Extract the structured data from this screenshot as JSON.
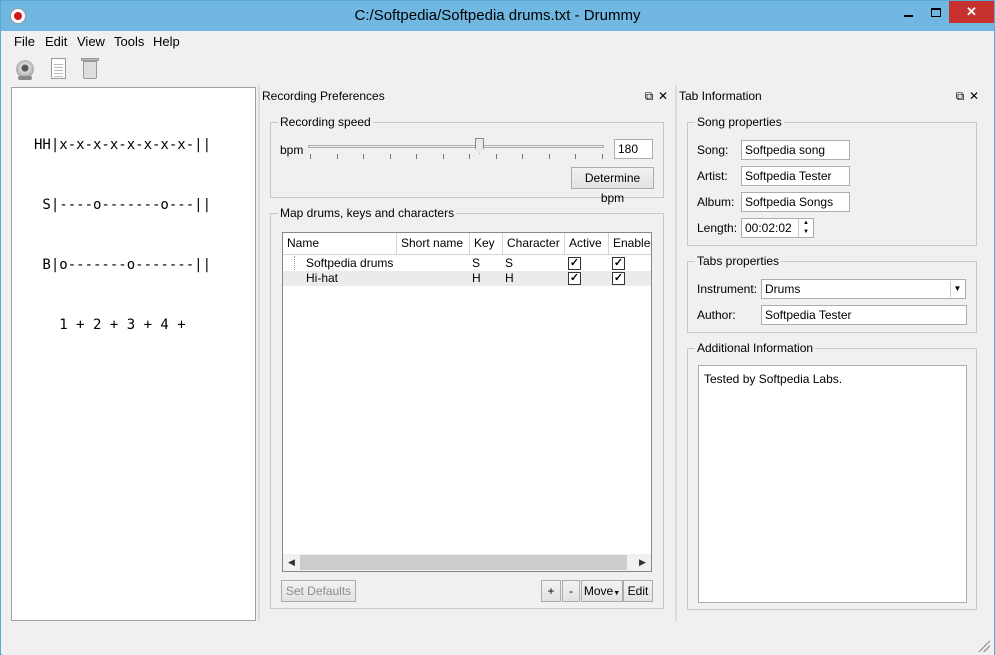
{
  "window": {
    "title": "C:/Softpedia/Softpedia drums.txt - Drummy"
  },
  "menu": [
    "File",
    "Edit",
    "View",
    "Tools",
    "Help"
  ],
  "toolbar": {
    "icons": [
      "record-icon",
      "new-document-icon",
      "trash-icon"
    ]
  },
  "tab_text": [
    "HH|x-x-x-x-x-x-x-x-||",
    " S|----o-------o---||",
    " B|o-------o-------||",
    "   1 + 2 + 3 + 4 +"
  ],
  "recording": {
    "panel_title": "Recording Preferences",
    "speed_group": "Recording speed",
    "bpm_label": "bpm",
    "bpm_value": "180",
    "slider_level": 0.58,
    "determine_button": "Determine bpm",
    "map_group": "Map drums, keys and characters",
    "columns": [
      "Name",
      "Short name",
      "Key",
      "Character",
      "Active",
      "Enabled"
    ],
    "rows": [
      {
        "name": "Softpedia drums",
        "short_name": "",
        "key": "S",
        "character": "S",
        "active": true,
        "enabled": true
      },
      {
        "name": "Hi-hat",
        "short_name": "",
        "key": "H",
        "character": "H",
        "active": true,
        "enabled": true
      }
    ],
    "set_defaults": "Set Defaults",
    "add": "+",
    "remove": "-",
    "move": "Move",
    "edit": "Edit"
  },
  "tabinfo": {
    "panel_title": "Tab Information",
    "song_group": "Song properties",
    "song_label": "Song:",
    "song_value": "Softpedia song",
    "artist_label": "Artist:",
    "artist_value": "Softpedia Tester",
    "album_label": "Album:",
    "album_value": "Softpedia Songs",
    "length_label": "Length:",
    "length_value": "00:02:02",
    "tabs_group": "Tabs properties",
    "instrument_label": "Instrument:",
    "instrument_value": "Drums",
    "author_label": "Author:",
    "author_value": "Softpedia Tester",
    "additional_group": "Additional Information",
    "additional_text": "Tested by Softpedia Labs."
  }
}
